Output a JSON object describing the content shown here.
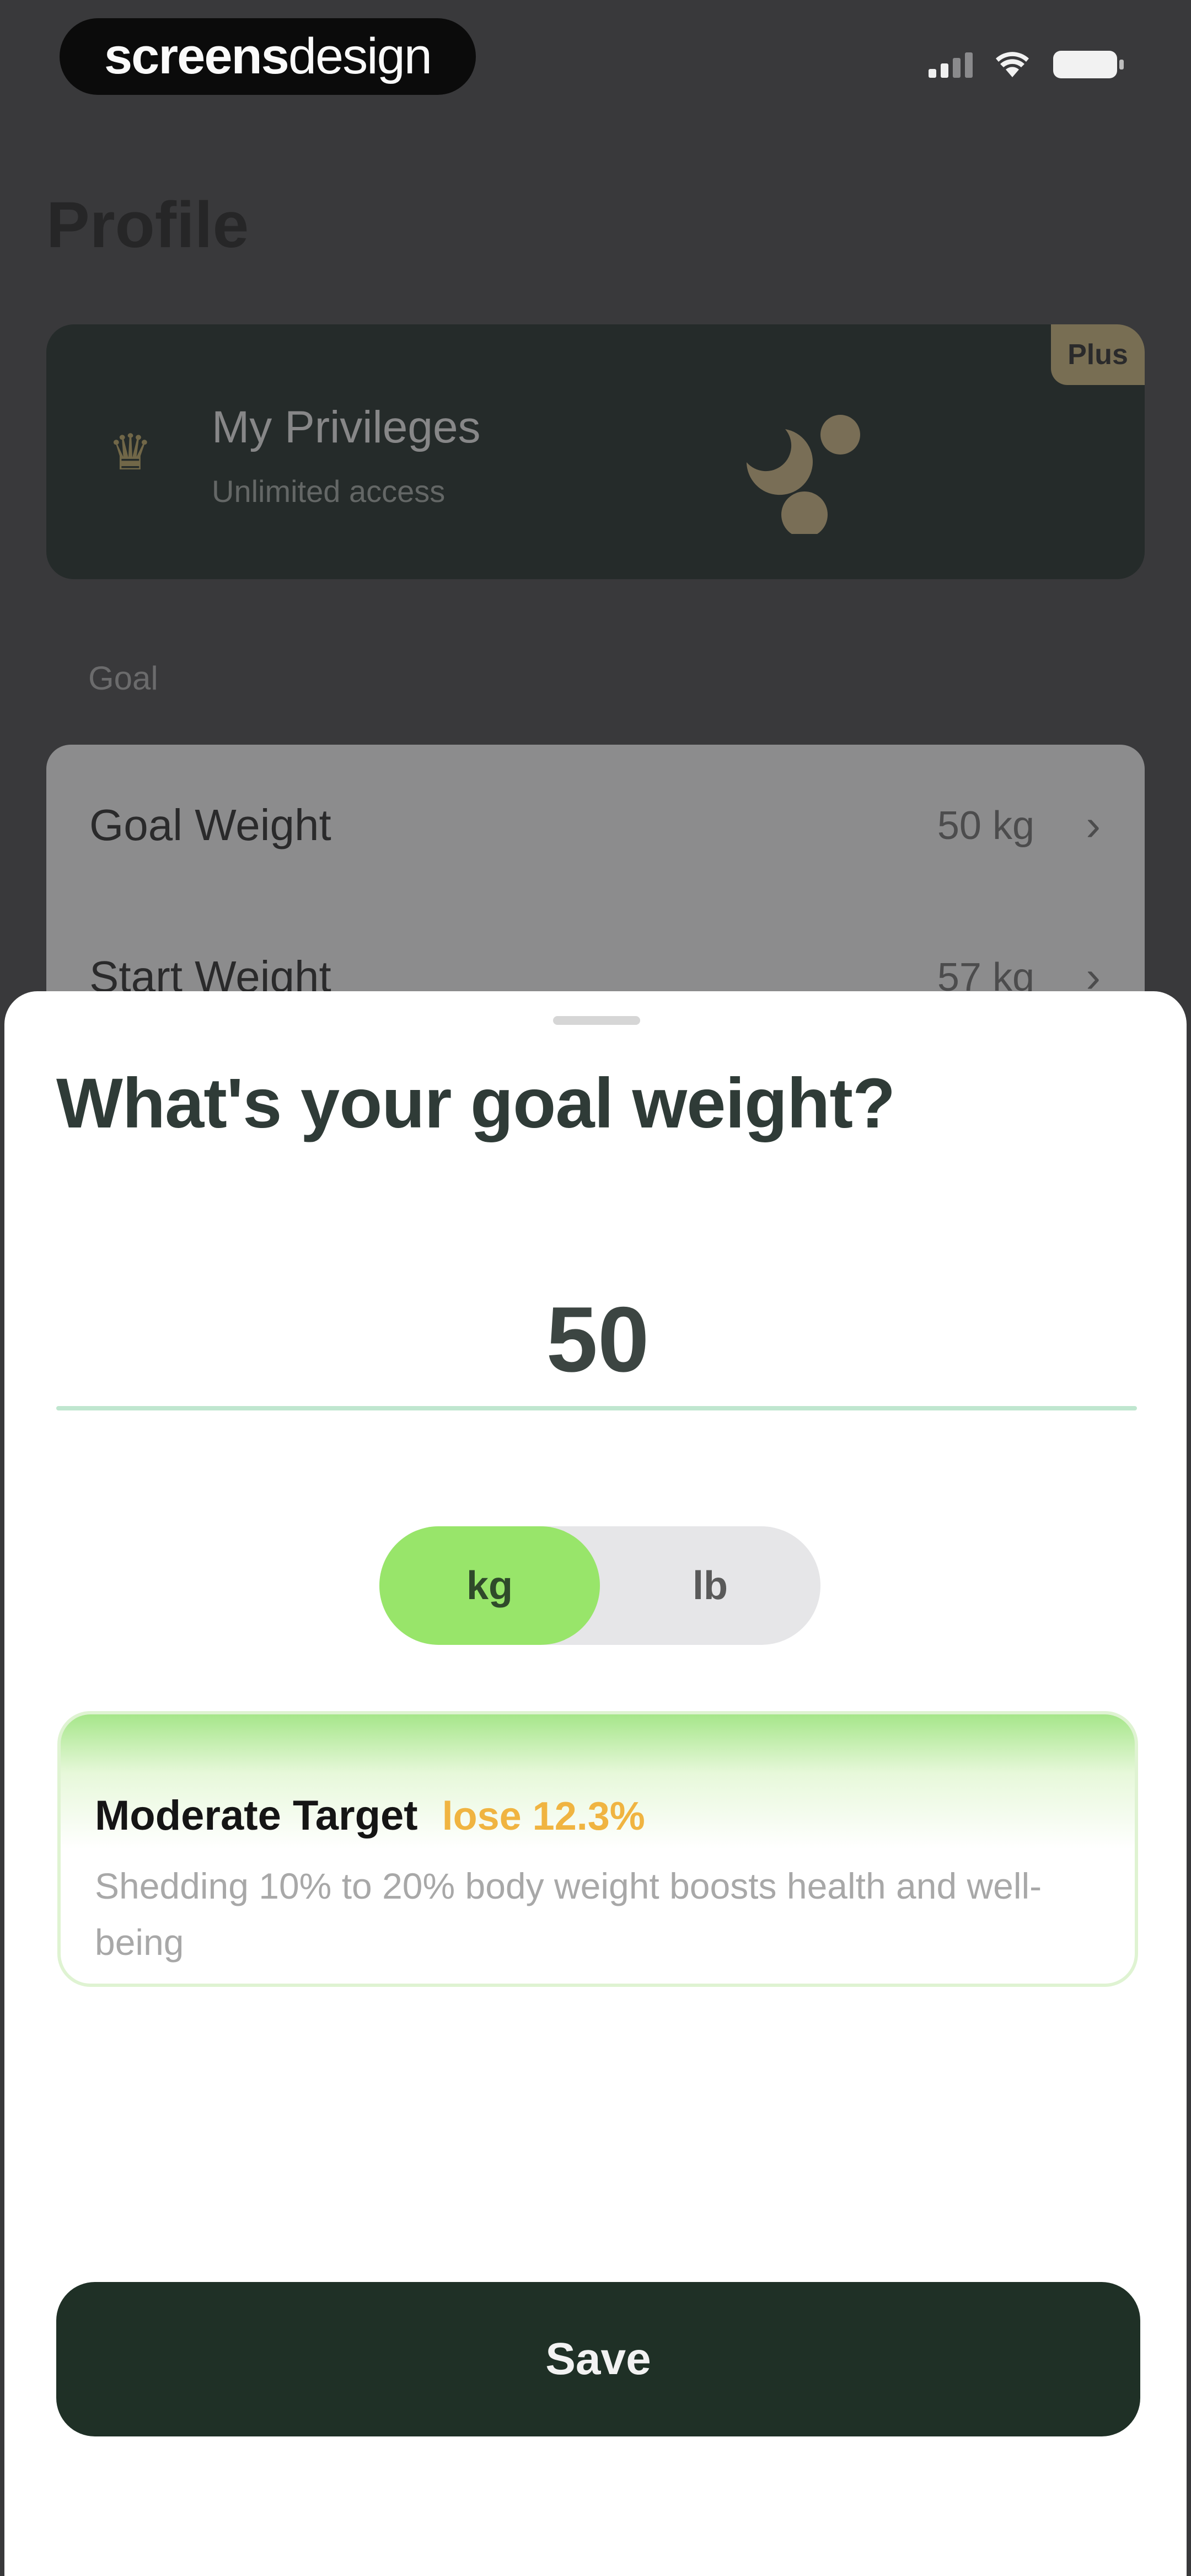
{
  "status_bar": {
    "brand_bold": "screens",
    "brand_light": "design"
  },
  "background_page": {
    "title": "Profile",
    "privileges": {
      "title": "My Privileges",
      "subtitle": "Unlimited access",
      "badge": "Plus"
    },
    "section_label": "Goal",
    "rows": [
      {
        "label": "Goal Weight",
        "value": "50 kg"
      },
      {
        "label": "Start Weight",
        "value": "57 kg"
      }
    ]
  },
  "sheet": {
    "title": "What's your goal weight?",
    "weight_value": "50",
    "units": {
      "selected": "kg",
      "options": [
        "kg",
        "lb"
      ]
    },
    "target": {
      "title": "Moderate Target",
      "change": "lose 12.3%",
      "description": "Shedding 10% to 20% body weight boosts health and well-being"
    },
    "save_label": "Save"
  },
  "colors": {
    "accent_green": "#98e56a",
    "save_button": "#1f3026",
    "target_orange": "#f0b441",
    "underline": "#bfe6cf"
  }
}
